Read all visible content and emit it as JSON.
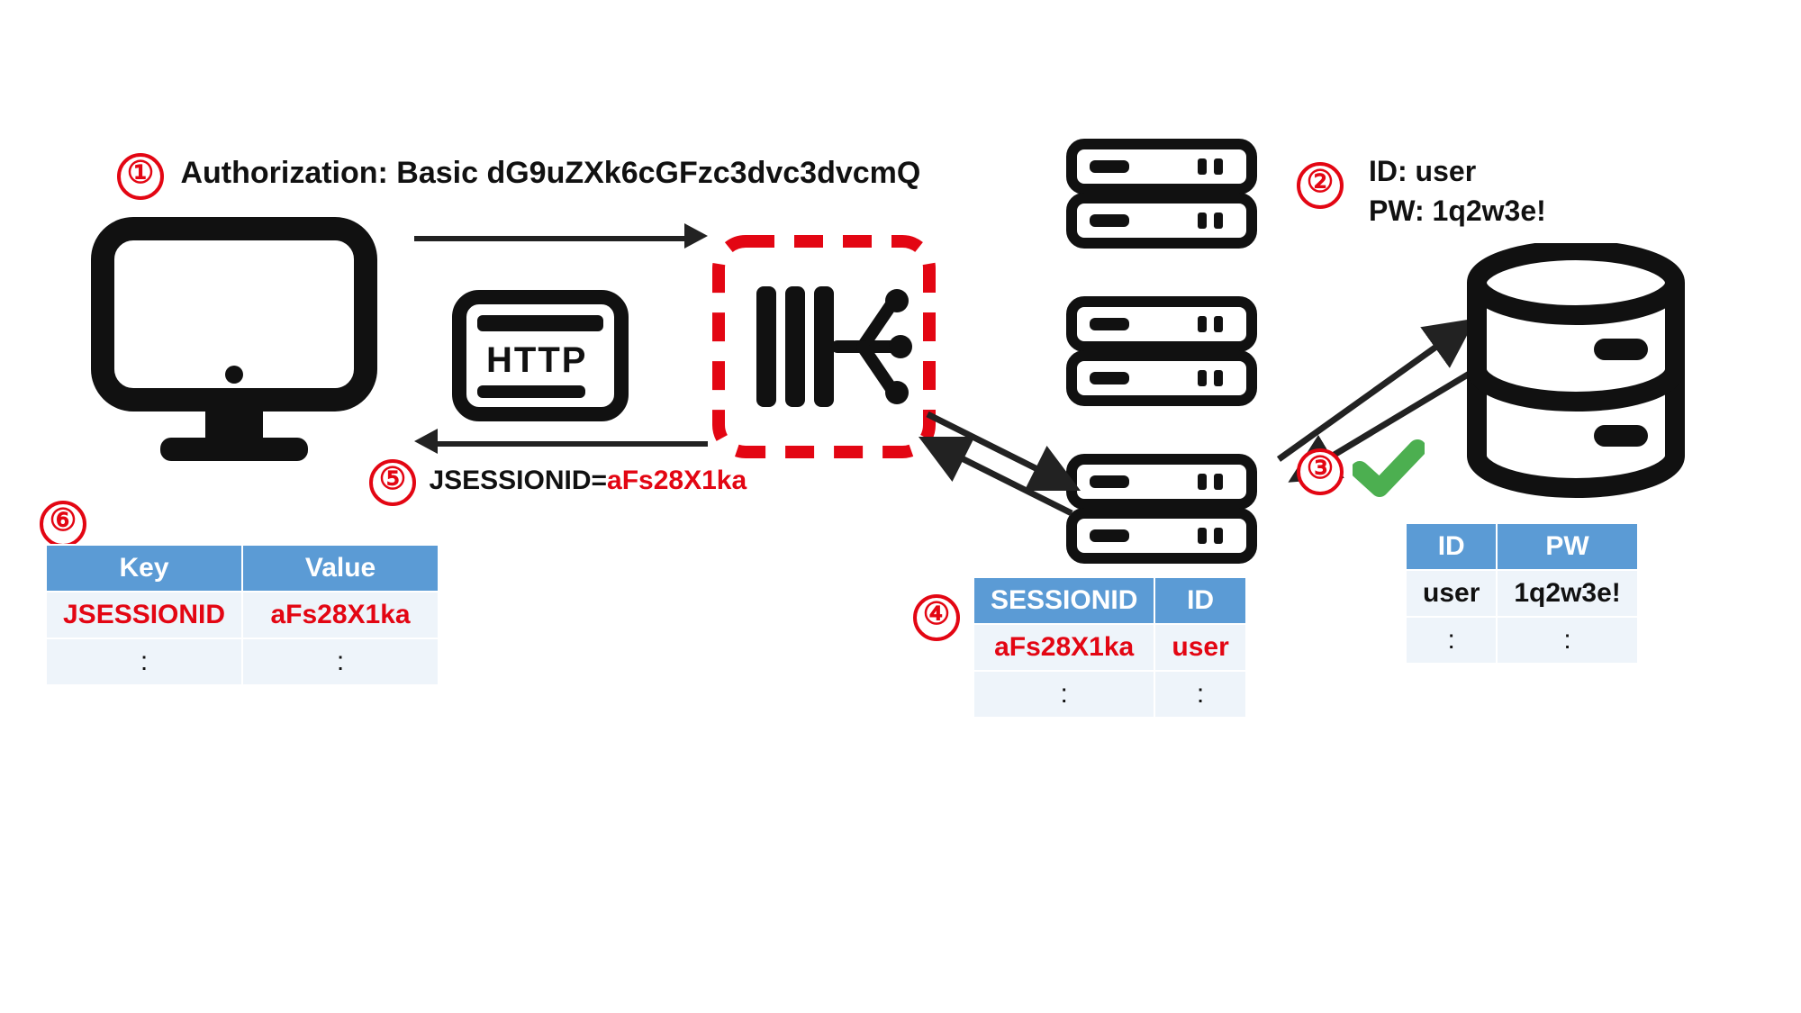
{
  "steps": {
    "s1": {
      "num": "①",
      "label": "Authorization: Basic dG9uZXk6cGFzc3dvc3dvcmQ"
    },
    "s2": {
      "num": "②",
      "id_line": "ID: user",
      "pw_line": "PW: 1q2w3e!"
    },
    "s3": {
      "num": "③"
    },
    "s4": {
      "num": "④"
    },
    "s5": {
      "num": "⑤",
      "label_prefix": "JSESSIONID=",
      "label_value": "aFs28X1ka"
    },
    "s6": {
      "num": "⑥"
    }
  },
  "http_label": "HTTP",
  "client_cookie_table": {
    "headers": [
      "Key",
      "Value"
    ],
    "rows": [
      {
        "k": "JSESSIONID",
        "v": "aFs28X1ka",
        "red": true
      },
      {
        "k": ":",
        "v": ":",
        "red": false
      }
    ]
  },
  "session_table": {
    "headers": [
      "SESSIONID",
      "ID"
    ],
    "rows": [
      {
        "k": "aFs28X1ka",
        "v": "user",
        "red": true
      },
      {
        "k": ":",
        "v": ":",
        "red": false
      }
    ]
  },
  "db_table": {
    "headers": [
      "ID",
      "PW"
    ],
    "rows": [
      {
        "k": "user",
        "v": "1q2w3e!",
        "red": false
      },
      {
        "k": ":",
        "v": ":",
        "red": false
      }
    ]
  },
  "icons": {
    "monitor": "monitor-icon",
    "http": "http-icon",
    "loadbalancer": "load-balancer-icon",
    "server": "server-icon",
    "database": "database-icon",
    "check": "check-icon"
  }
}
